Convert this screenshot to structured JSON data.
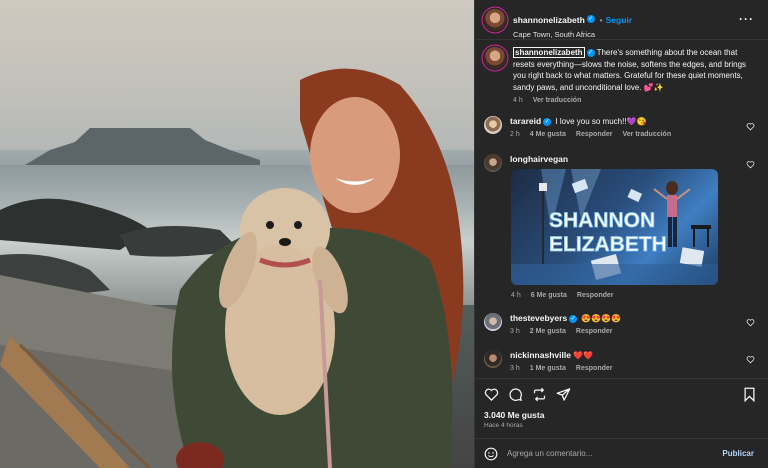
{
  "post": {
    "username": "shannonelizabeth",
    "follow_label": "Seguir",
    "location": "Cape Town, South Africa",
    "caption": "There's something about the ocean that resets everything—slows the noise, softens the edges, and brings you right back to what matters. Grateful for these quiet moments, sandy paws, and unconditional love. 💕✨",
    "caption_age": "4 h",
    "see_translation": "Ver traducción"
  },
  "comments": [
    {
      "username": "tarareid",
      "text": "I love you so much!!💜😘",
      "age": "2 h",
      "likes": "4 Me gusta",
      "reply": "Responder",
      "translation": "Ver traducción"
    },
    {
      "username": "longhairvegan",
      "sticker_title_line1": "SHANNON",
      "sticker_title_line2": "ELIZABETH",
      "age": "4 h",
      "likes": "6 Me gusta",
      "reply": "Responder"
    },
    {
      "username": "thestevebyers",
      "text": "😍😍😍😍",
      "age": "3 h",
      "likes": "2 Me gusta",
      "reply": "Responder"
    },
    {
      "username": "nickinnashville",
      "text": "❤️❤️",
      "age": "3 h",
      "likes": "1 Me gusta",
      "reply": "Responder"
    }
  ],
  "footer": {
    "likes_count": "3.040 Me gusta",
    "posted_ago": "Hace 4 horas",
    "comment_placeholder": "Agrega un comentario...",
    "publish_label": "Publicar"
  },
  "icons": {
    "more": "more-options-icon",
    "like": "heart-icon",
    "comment": "comment-icon",
    "share": "share-icon",
    "send": "send-icon",
    "save": "bookmark-icon",
    "emoji": "emoji-icon"
  },
  "colors": {
    "accent": "#0095f6",
    "panel_bg": "#262626",
    "secondary_text": "#a8a8a8"
  }
}
